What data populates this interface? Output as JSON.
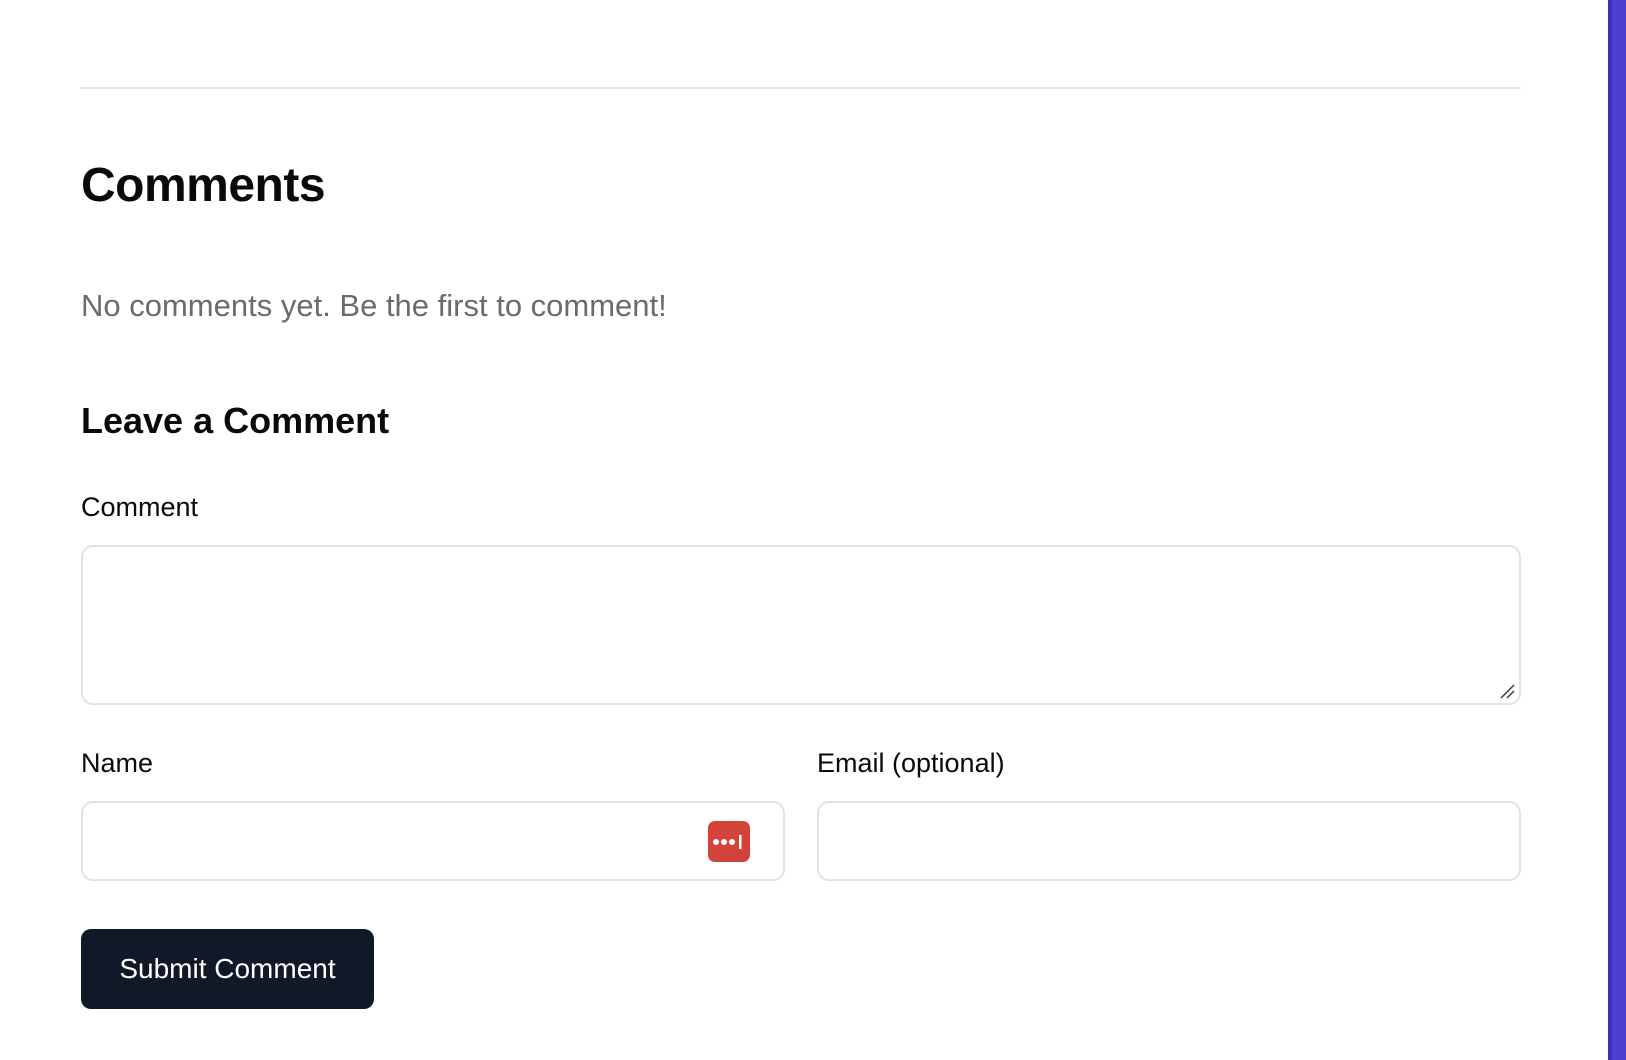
{
  "comments": {
    "title": "Comments",
    "empty_message": "No comments yet. Be the first to comment!"
  },
  "form": {
    "title": "Leave a Comment",
    "comment_label": "Comment",
    "comment_value": "",
    "name_label": "Name",
    "name_value": "",
    "email_label": "Email (optional)",
    "email_value": "",
    "submit_label": "Submit Comment"
  },
  "icons": {
    "password_manager": "password-manager-icon",
    "resize": "resize-grip-icon"
  },
  "colors": {
    "button_bg": "#111827",
    "password_icon": "#d2433a",
    "side_accent": "#4c3fd1"
  }
}
